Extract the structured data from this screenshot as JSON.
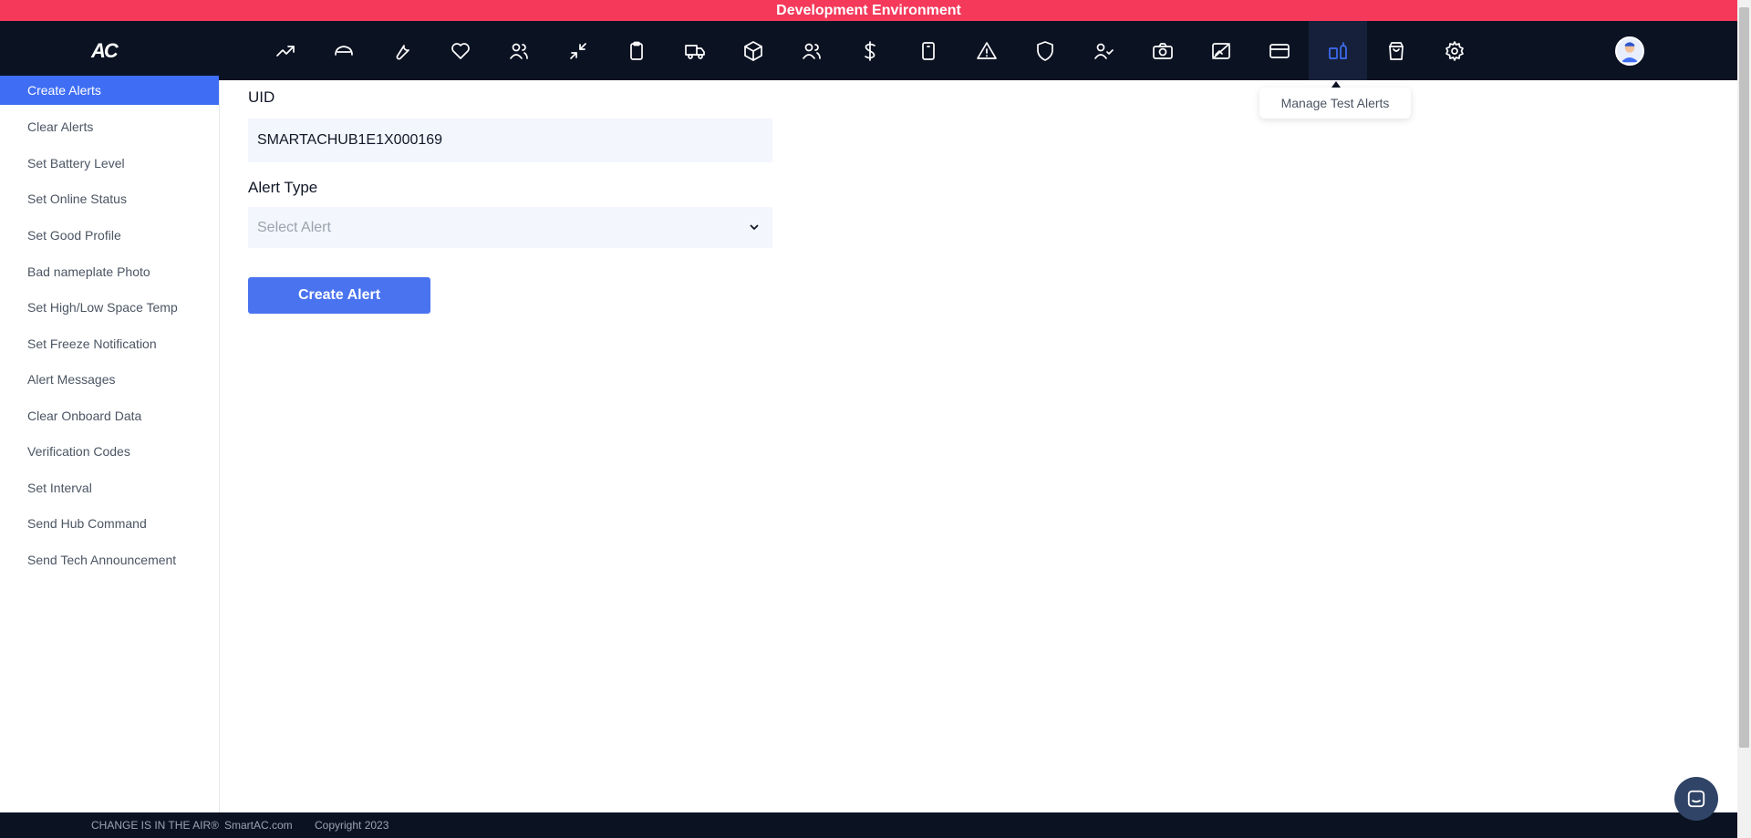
{
  "banner": {
    "text": "Development Environment"
  },
  "brand": {
    "logo_text": "AC"
  },
  "nav": {
    "icons": [
      "trending-icon",
      "car-icon",
      "wrench-icon",
      "heart-icon",
      "users-icon",
      "minimize-icon",
      "clipboard-icon",
      "truck-icon",
      "box-icon",
      "users-group-icon",
      "dollar-icon",
      "device-icon",
      "warning-icon",
      "shield-icon",
      "user-check-icon",
      "camera-icon",
      "image-off-icon",
      "credit-card-icon",
      "test-alert-icon",
      "shopping-bag-icon",
      "gear-icon"
    ],
    "active_index": 18,
    "tooltip": "Manage Test Alerts"
  },
  "sidebar": {
    "items": [
      {
        "label": "Create Alerts",
        "active": true
      },
      {
        "label": "Clear Alerts"
      },
      {
        "label": "Set Battery Level"
      },
      {
        "label": "Set Online Status"
      },
      {
        "label": "Set Good Profile"
      },
      {
        "label": "Bad nameplate Photo"
      },
      {
        "label": "Set High/Low Space Temp"
      },
      {
        "label": "Set Freeze Notification"
      },
      {
        "label": "Alert Messages"
      },
      {
        "label": "Clear Onboard Data"
      },
      {
        "label": "Verification Codes"
      },
      {
        "label": "Set Interval"
      },
      {
        "label": "Send Hub Command"
      },
      {
        "label": "Send Tech Announcement"
      }
    ]
  },
  "form": {
    "uid_label": "UID",
    "uid_value": "SMARTACHUB1E1X000169",
    "alert_type_label": "Alert Type",
    "alert_type_placeholder": "Select Alert",
    "submit_label": "Create Alert"
  },
  "footer": {
    "tagline": "CHANGE IS IN THE AIR®",
    "site": "SmartAC.com",
    "copyright": "Copyright 2023"
  },
  "colors": {
    "banner": "#f4395b",
    "nav_bg": "#0b1222",
    "accent": "#3f6ef5"
  }
}
